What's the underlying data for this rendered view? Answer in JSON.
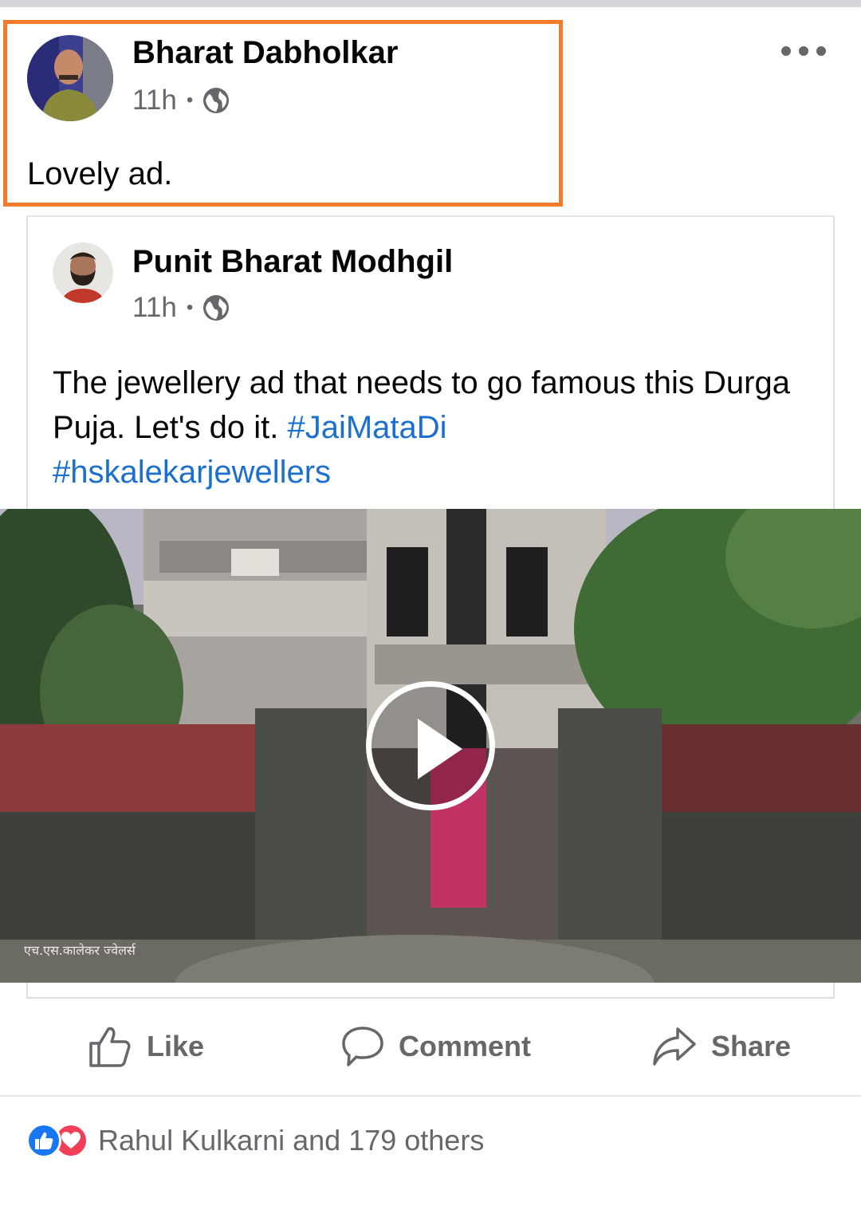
{
  "post": {
    "author": "Bharat Dabholkar",
    "time": "11h",
    "separator": "•",
    "privacy_icon": "globe-icon",
    "text": "Lovely ad.",
    "more_icon": "more-options-icon"
  },
  "shared_post": {
    "author": "Punit Bharat Modhgil",
    "time": "11h",
    "separator": "•",
    "privacy_icon": "globe-icon",
    "text": "The jewellery ad that needs to go famous this Durga Puja. Let's do it.",
    "hashtags": [
      "#JaiMataDi",
      "#hskalekarjewellers"
    ],
    "video": {
      "play_icon": "play-icon",
      "watermark": "एच.एस.कालेकर ज्वेलर्स"
    }
  },
  "actions": {
    "like": "Like",
    "comment": "Comment",
    "share": "Share"
  },
  "reactions": {
    "icons": [
      "like-reaction-icon",
      "love-reaction-icon"
    ],
    "summary": "Rahul Kulkarni and 179 others"
  },
  "colors": {
    "highlight": "#f47b2a",
    "hashtag": "#1b6fcf",
    "like_blue": "#1877f2",
    "love_red": "#f33e58",
    "secondary_text": "#65676b"
  }
}
